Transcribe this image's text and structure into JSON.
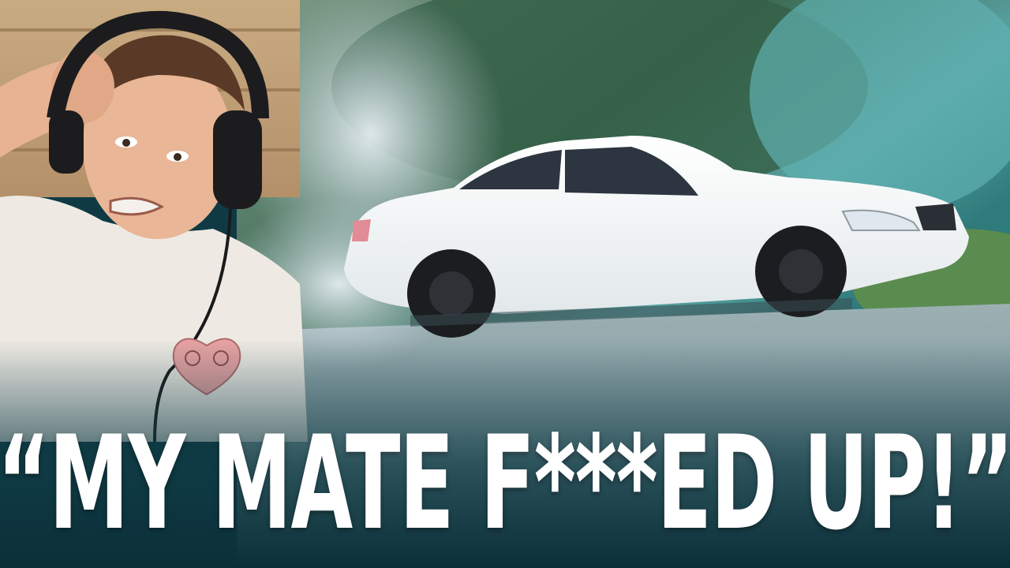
{
  "thumbnail": {
    "headline": "“MY MATE F***ED UP!”"
  },
  "colors": {
    "headline_text": "#ffffff",
    "gradient_bottom": "#0f3a44",
    "car_body": "#f4f6f6",
    "road": "#8fa3a6",
    "trees": "#2f5e45",
    "smoke": "#cfdde6"
  },
  "scene": {
    "left_subject": "man-wearing-headphones-reacting",
    "right_subject": "white-coupe-car-drifting-with-tire-smoke",
    "shirt_graphic": "heart-turbo-logo"
  }
}
